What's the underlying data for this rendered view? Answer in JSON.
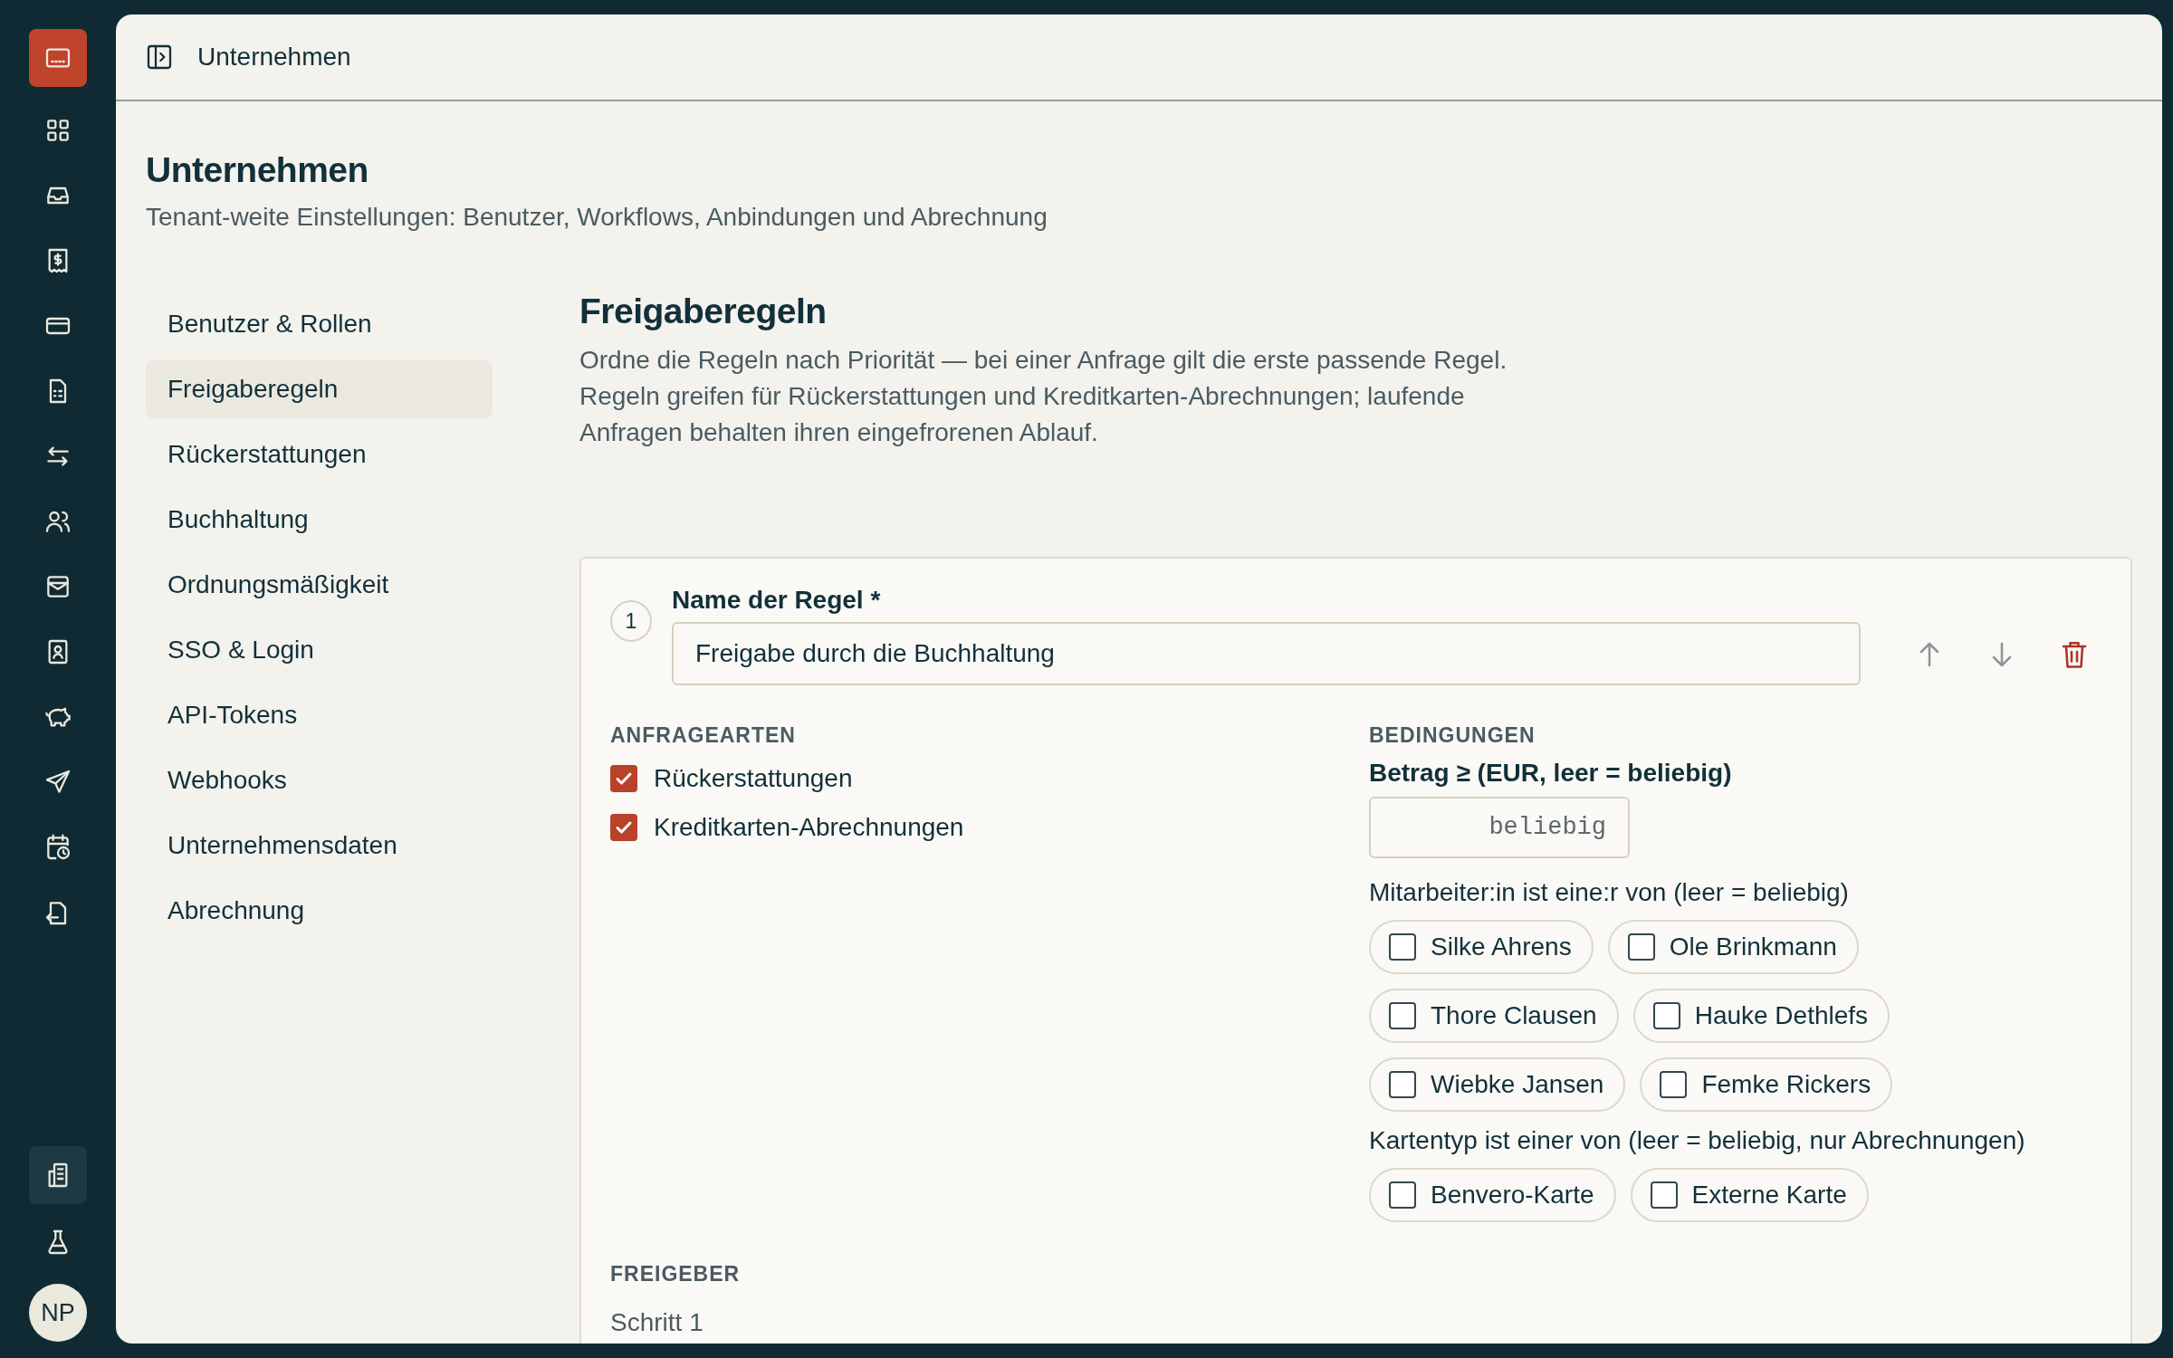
{
  "rail": {
    "items": [
      {
        "selected": false
      },
      {
        "selected": false
      },
      {
        "selected": false
      },
      {
        "selected": false
      },
      {
        "selected": false
      },
      {
        "selected": false
      },
      {
        "selected": false
      },
      {
        "selected": false
      },
      {
        "selected": false
      },
      {
        "selected": false
      },
      {
        "selected": false
      },
      {
        "selected": false
      },
      {
        "selected": false
      },
      {
        "selected": false
      }
    ],
    "bottom": [
      {
        "selected": true
      },
      {
        "selected": false
      }
    ],
    "avatar": "NP"
  },
  "topbar": {
    "title": "Unternehmen"
  },
  "page": {
    "title": "Unternehmen",
    "subtitle": "Tenant-weite Einstellungen: Benutzer, Workflows, Anbindungen und Abrechnung"
  },
  "settings_nav": [
    {
      "label": "Benutzer & Rollen",
      "selected": false
    },
    {
      "label": "Freigaberegeln",
      "selected": true
    },
    {
      "label": "Rückerstattungen",
      "selected": false
    },
    {
      "label": "Buchhaltung",
      "selected": false
    },
    {
      "label": "Ordnungsmäßigkeit",
      "selected": false
    },
    {
      "label": "SSO & Login",
      "selected": false
    },
    {
      "label": "API-Tokens",
      "selected": false
    },
    {
      "label": "Webhooks",
      "selected": false
    },
    {
      "label": "Unternehmensdaten",
      "selected": false
    },
    {
      "label": "Abrechnung",
      "selected": false
    }
  ],
  "section": {
    "title": "Freigaberegeln",
    "description": "Ordne die Regeln nach Priorität — bei einer Anfrage gilt die erste passende Regel. Regeln greifen für Rückerstattungen und Kreditkarten-Abrechnungen; laufende Anfragen behalten ihren eingefrorenen Ablauf."
  },
  "rule": {
    "number": "1",
    "name_label": "Name der Regel *",
    "name_value": "Freigabe durch die Buchhaltung",
    "request_types": {
      "heading": "ANFRAGEARTEN",
      "options": [
        {
          "label": "Rückerstattungen",
          "checked": true
        },
        {
          "label": "Kreditkarten-Abrechnungen",
          "checked": true
        }
      ]
    },
    "conditions": {
      "heading": "BEDINGUNGEN",
      "amount_label": "Betrag ≥ (EUR, leer = beliebig)",
      "amount_placeholder": "beliebig",
      "employees_label": "Mitarbeiter:in ist eine:r von (leer = beliebig)",
      "employees": [
        {
          "label": "Silke Ahrens",
          "checked": false
        },
        {
          "label": "Ole Brinkmann",
          "checked": false
        },
        {
          "label": "Thore Clausen",
          "checked": false
        },
        {
          "label": "Hauke Dethlefs",
          "checked": false
        },
        {
          "label": "Wiebke Jansen",
          "checked": false
        },
        {
          "label": "Femke Rickers",
          "checked": false
        }
      ],
      "card_type_label": "Kartentyp ist einer von (leer = beliebig, nur Abrechnungen)",
      "card_types": [
        {
          "label": "Benvero-Karte",
          "checked": false
        },
        {
          "label": "Externe Karte",
          "checked": false
        }
      ]
    },
    "approvers": {
      "heading": "FREIGEBER",
      "step": "Schritt 1"
    }
  }
}
